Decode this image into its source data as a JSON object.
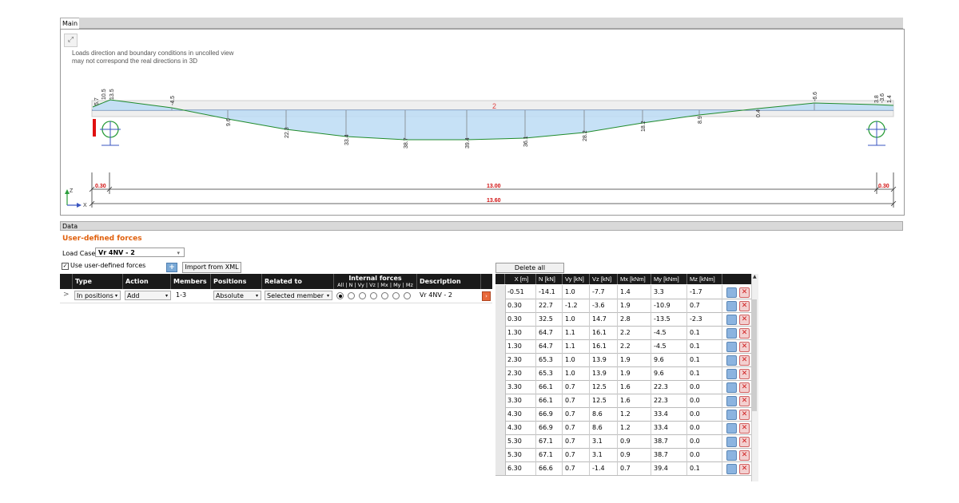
{
  "main": {
    "tab_label": "Main",
    "note_line1": "Loads direction and boundary conditions in uncolled view",
    "note_line2": "may not correspond the real directions in 3D",
    "member_label": "2",
    "diagram_values": [
      {
        "v": "5.7"
      },
      {
        "v": "10.5"
      },
      {
        "v": "13.5"
      },
      {
        "v": "-4.5"
      },
      {
        "v": "9.6"
      },
      {
        "v": "22.3"
      },
      {
        "v": "33.4"
      },
      {
        "v": "38.7"
      },
      {
        "v": "39.4"
      },
      {
        "v": "36.1"
      },
      {
        "v": "28.2"
      },
      {
        "v": "18.2"
      },
      {
        "v": "8.9"
      },
      {
        "v": "0.4"
      },
      {
        "v": "-6.6"
      },
      {
        "v": "3.8"
      },
      {
        "v": "-3.6"
      },
      {
        "v": "1.4"
      }
    ],
    "dims": {
      "left": "0.30",
      "middle": "13.00",
      "right": "0.30",
      "total": "13.60"
    },
    "axis_z": "Z",
    "axis_x": "X"
  },
  "data": {
    "header": "Data",
    "section_title": "User-defined forces",
    "load_case_label": "Load Case",
    "load_case_value": "Vr 4NV - 2",
    "use_udf_label": "Use user-defined forces",
    "import_label": "Import from XML",
    "delete_all_label": "Delete all",
    "left_table": {
      "headers": [
        "Type",
        "Action",
        "Members",
        "Positions",
        "Related to",
        "Internal forces",
        "Description"
      ],
      "internal_sub": "All | N | Vy | Vz | Mx | My | Mz",
      "row": {
        "marker": ">",
        "type": "In positions",
        "action": "Add",
        "members": "1-3",
        "positions": "Absolute",
        "related": "Selected member",
        "description": "Vr 4NV - 2"
      }
    },
    "right_table": {
      "headers": [
        "X [m]",
        "N [kN]",
        "Vy [kN]",
        "Vz [kN]",
        "Mx [kNm]",
        "My [kNm]",
        "Mz [kNm]"
      ],
      "rows": [
        [
          "-0.51",
          "-14.1",
          "1.0",
          "-7.7",
          "1.4",
          "3.3",
          "-1.7"
        ],
        [
          "0.30",
          "22.7",
          "-1.2",
          "-3.6",
          "1.9",
          "-10.9",
          "0.7"
        ],
        [
          "0.30",
          "32.5",
          "1.0",
          "14.7",
          "2.8",
          "-13.5",
          "-2.3"
        ],
        [
          "1.30",
          "64.7",
          "1.1",
          "16.1",
          "2.2",
          "-4.5",
          "0.1"
        ],
        [
          "1.30",
          "64.7",
          "1.1",
          "16.1",
          "2.2",
          "-4.5",
          "0.1"
        ],
        [
          "2.30",
          "65.3",
          "1.0",
          "13.9",
          "1.9",
          "9.6",
          "0.1"
        ],
        [
          "2.30",
          "65.3",
          "1.0",
          "13.9",
          "1.9",
          "9.6",
          "0.1"
        ],
        [
          "3.30",
          "66.1",
          "0.7",
          "12.5",
          "1.6",
          "22.3",
          "0.0"
        ],
        [
          "3.30",
          "66.1",
          "0.7",
          "12.5",
          "1.6",
          "22.3",
          "0.0"
        ],
        [
          "4.30",
          "66.9",
          "0.7",
          "8.6",
          "1.2",
          "33.4",
          "0.0"
        ],
        [
          "4.30",
          "66.9",
          "0.7",
          "8.6",
          "1.2",
          "33.4",
          "0.0"
        ],
        [
          "5.30",
          "67.1",
          "0.7",
          "3.1",
          "0.9",
          "38.7",
          "0.0"
        ],
        [
          "5.30",
          "67.1",
          "0.7",
          "3.1",
          "0.9",
          "38.7",
          "0.0"
        ],
        [
          "6.30",
          "66.6",
          "0.7",
          "-1.4",
          "0.7",
          "39.4",
          "0.1"
        ]
      ]
    }
  }
}
